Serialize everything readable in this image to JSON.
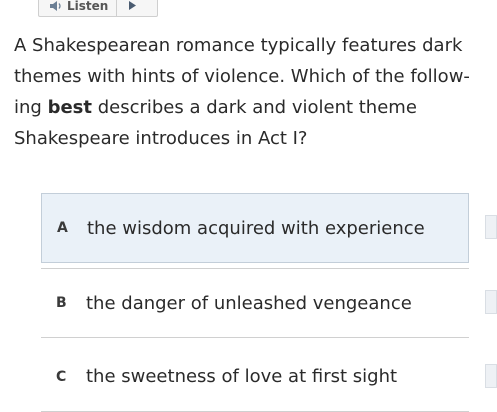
{
  "toolbar": {
    "listen_label": "Listen",
    "speaker_icon": "speaker-icon",
    "play_icon": "play-icon"
  },
  "question": {
    "text_before": "A Shakespearean romance typically features dark themes with hints of violence. Which of the follow-ing ",
    "emphasis": "best",
    "text_after": " describes a dark and violent theme Shakespeare introduces in Act I?"
  },
  "choices": [
    {
      "letter": "A",
      "text": "the wisdom acquired with experience"
    },
    {
      "letter": "B",
      "text": "the danger of unleashed vengeance"
    },
    {
      "letter": "C",
      "text": "the sweetness of love at first sight"
    }
  ],
  "colors": {
    "selected_bg": "#eaf1f8",
    "text": "#2a2a2a"
  }
}
